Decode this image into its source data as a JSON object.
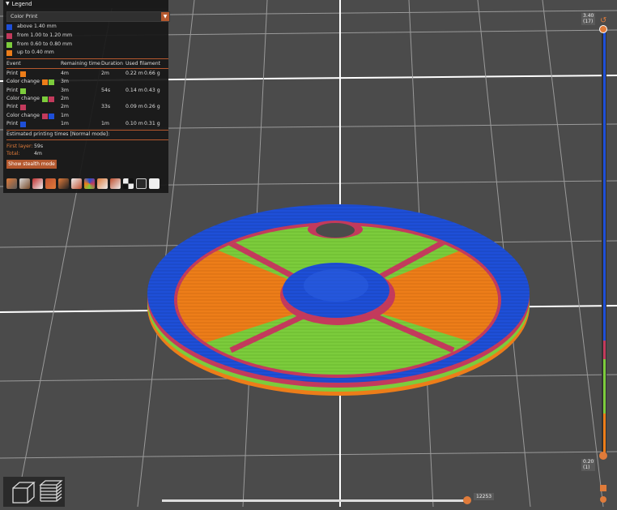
{
  "legend": {
    "title": "Legend",
    "view_type": "Color Print",
    "ranges": [
      {
        "label": "above 1.40 mm",
        "color": "#1e4fd8"
      },
      {
        "label": "from 1.00 to 1.20 mm",
        "color": "#c33a5c"
      },
      {
        "label": "from 0.60 to 0.80 mm",
        "color": "#7ccc3c"
      },
      {
        "label": "up to 0.40 mm",
        "color": "#ed7d19"
      }
    ],
    "columns": {
      "event": "Event",
      "remaining": "Remaining time",
      "duration": "Duration",
      "filament": "Used filament"
    },
    "events": [
      {
        "event": "Print",
        "colors": [
          "#ed7d19"
        ],
        "remaining": "4m",
        "duration": "2m",
        "length": "0.22 m",
        "weight": "0.66 g"
      },
      {
        "event": "Color change",
        "colors": [
          "#ed7d19",
          "#7ccc3c"
        ],
        "remaining": "3m",
        "duration": "",
        "length": "",
        "weight": ""
      },
      {
        "event": "Print",
        "colors": [
          "#7ccc3c"
        ],
        "remaining": "3m",
        "duration": "54s",
        "length": "0.14 m",
        "weight": "0.43 g"
      },
      {
        "event": "Color change",
        "colors": [
          "#7ccc3c",
          "#c33a5c"
        ],
        "remaining": "2m",
        "duration": "",
        "length": "",
        "weight": ""
      },
      {
        "event": "Print",
        "colors": [
          "#c33a5c"
        ],
        "remaining": "2m",
        "duration": "33s",
        "length": "0.09 m",
        "weight": "0.26 g"
      },
      {
        "event": "Color change",
        "colors": [
          "#c33a5c",
          "#1e4fd8"
        ],
        "remaining": "1m",
        "duration": "",
        "length": "",
        "weight": ""
      },
      {
        "event": "Print",
        "colors": [
          "#1e4fd8"
        ],
        "remaining": "1m",
        "duration": "1m",
        "length": "0.10 m",
        "weight": "0.31 g"
      }
    ],
    "estimated_title": "Estimated printing times [Normal mode]:",
    "first_layer_label": "First layer:",
    "first_layer_value": "59s",
    "total_label": "Total:",
    "total_value": "4m",
    "stealth_button": "Show stealth mode",
    "toolbar_icons": [
      "travel-icon",
      "wipe-icon",
      "retractions-icon",
      "deretractions-icon",
      "seams-icon",
      "tool-changes-icon",
      "color-changes-icon",
      "pause-prints-icon",
      "custom-gcodes-icon",
      "center-of-gravity-icon",
      "shells-icon",
      "tool-marker-icon"
    ]
  },
  "layer_slider": {
    "top_value": "3.40",
    "top_layer": "(17)",
    "bottom_value": "0.20",
    "bottom_layer": "(1)"
  },
  "move_slider": {
    "value": "12253"
  },
  "accent_color": "#e07b3a"
}
